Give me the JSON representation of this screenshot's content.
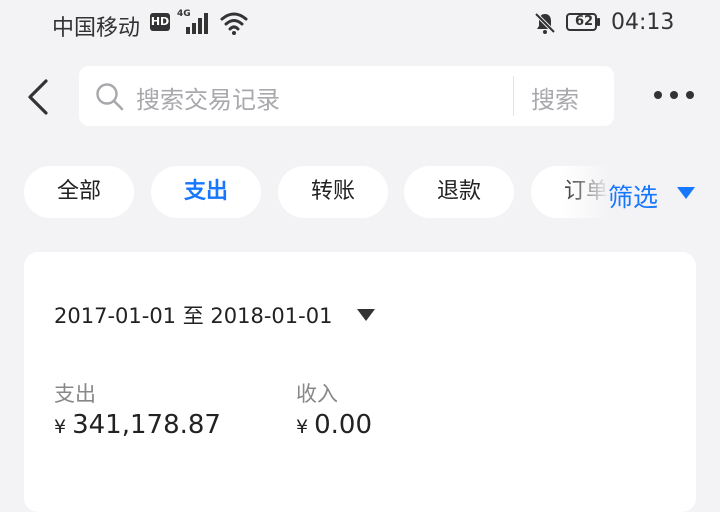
{
  "status_bar": {
    "carrier": "中国移动",
    "hd": "HD",
    "network": "4G",
    "battery": "62",
    "time": "04:13"
  },
  "header": {
    "search_placeholder": "搜索交易记录",
    "search_button": "搜索"
  },
  "tabs": [
    {
      "label": "全部",
      "active": false
    },
    {
      "label": "支出",
      "active": true
    },
    {
      "label": "转账",
      "active": false
    },
    {
      "label": "退款",
      "active": false
    },
    {
      "label": "订单",
      "active": false
    }
  ],
  "filter_label": "筛选",
  "summary": {
    "date_range": "2017-01-01 至 2018-01-01",
    "expense_label": "支出",
    "expense_currency": "¥",
    "expense_value": "341,178.87",
    "income_label": "收入",
    "income_currency": "¥",
    "income_value": "0.00"
  },
  "colors": {
    "accent": "#1677ff",
    "background": "#f3f3f5",
    "placeholder": "#a8a8ad"
  }
}
